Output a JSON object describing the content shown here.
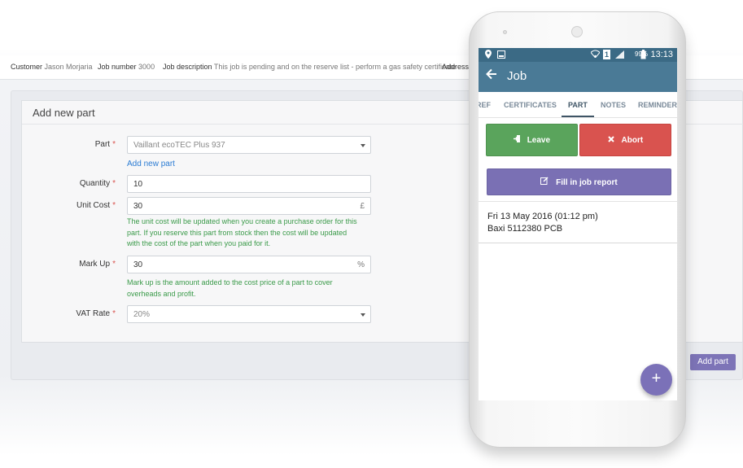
{
  "info_bar": {
    "customer_label": "Customer",
    "customer_value": "Jason Morjaria",
    "job_number_label": "Job number",
    "job_number_value": "3000",
    "job_description_label": "Job description",
    "job_description_value": "This job is pending and on the reserve list - perform a gas safety certificate",
    "address_label": "Address"
  },
  "form": {
    "title": "Add new part",
    "part_label": "Part",
    "part_value": "Vaillant ecoTEC Plus 937",
    "add_new_part_link": "Add new part",
    "quantity_label": "Quantity",
    "quantity_value": "10",
    "unit_cost_label": "Unit Cost",
    "unit_cost_value": "30",
    "unit_cost_addon": "£",
    "unit_cost_help_1": "The unit cost will be updated when you create a purchase order for this",
    "unit_cost_help_2": "part. If you reserve this part from stock then the cost will be updated",
    "unit_cost_help_3": "with the cost of the part when you paid for it.",
    "markup_label": "Mark Up",
    "markup_value": "30",
    "markup_addon": "%",
    "markup_help_1": "Mark up is the amount added to the cost price of a part to cover",
    "markup_help_2": "overheads and profit.",
    "vat_label": "VAT Rate",
    "vat_value": "20%",
    "required_mark": "*",
    "add_part_button": "Add part"
  },
  "phone": {
    "status": {
      "battery": "99%",
      "time": "13:13",
      "sim": "1"
    },
    "app_bar_title": "Job",
    "tabs": [
      "REF",
      "CERTIFICATES",
      "PART",
      "NOTES",
      "REMINDER"
    ],
    "active_tab": "PART",
    "leave_button": "Leave",
    "abort_button": "Abort",
    "report_button": "Fill in job report",
    "entry_line_1": "Fri 13 May 2016 (01:12 pm)",
    "entry_line_2": "Baxi 5112380 PCB",
    "fab_label": "+"
  },
  "colors": {
    "accent_purple": "#7a70b4",
    "leave_green": "#5aa45c",
    "abort_red": "#d9534f",
    "app_bar_blue": "#4a7a96",
    "help_green": "#3a9a49",
    "link_blue": "#2a7bd3"
  }
}
